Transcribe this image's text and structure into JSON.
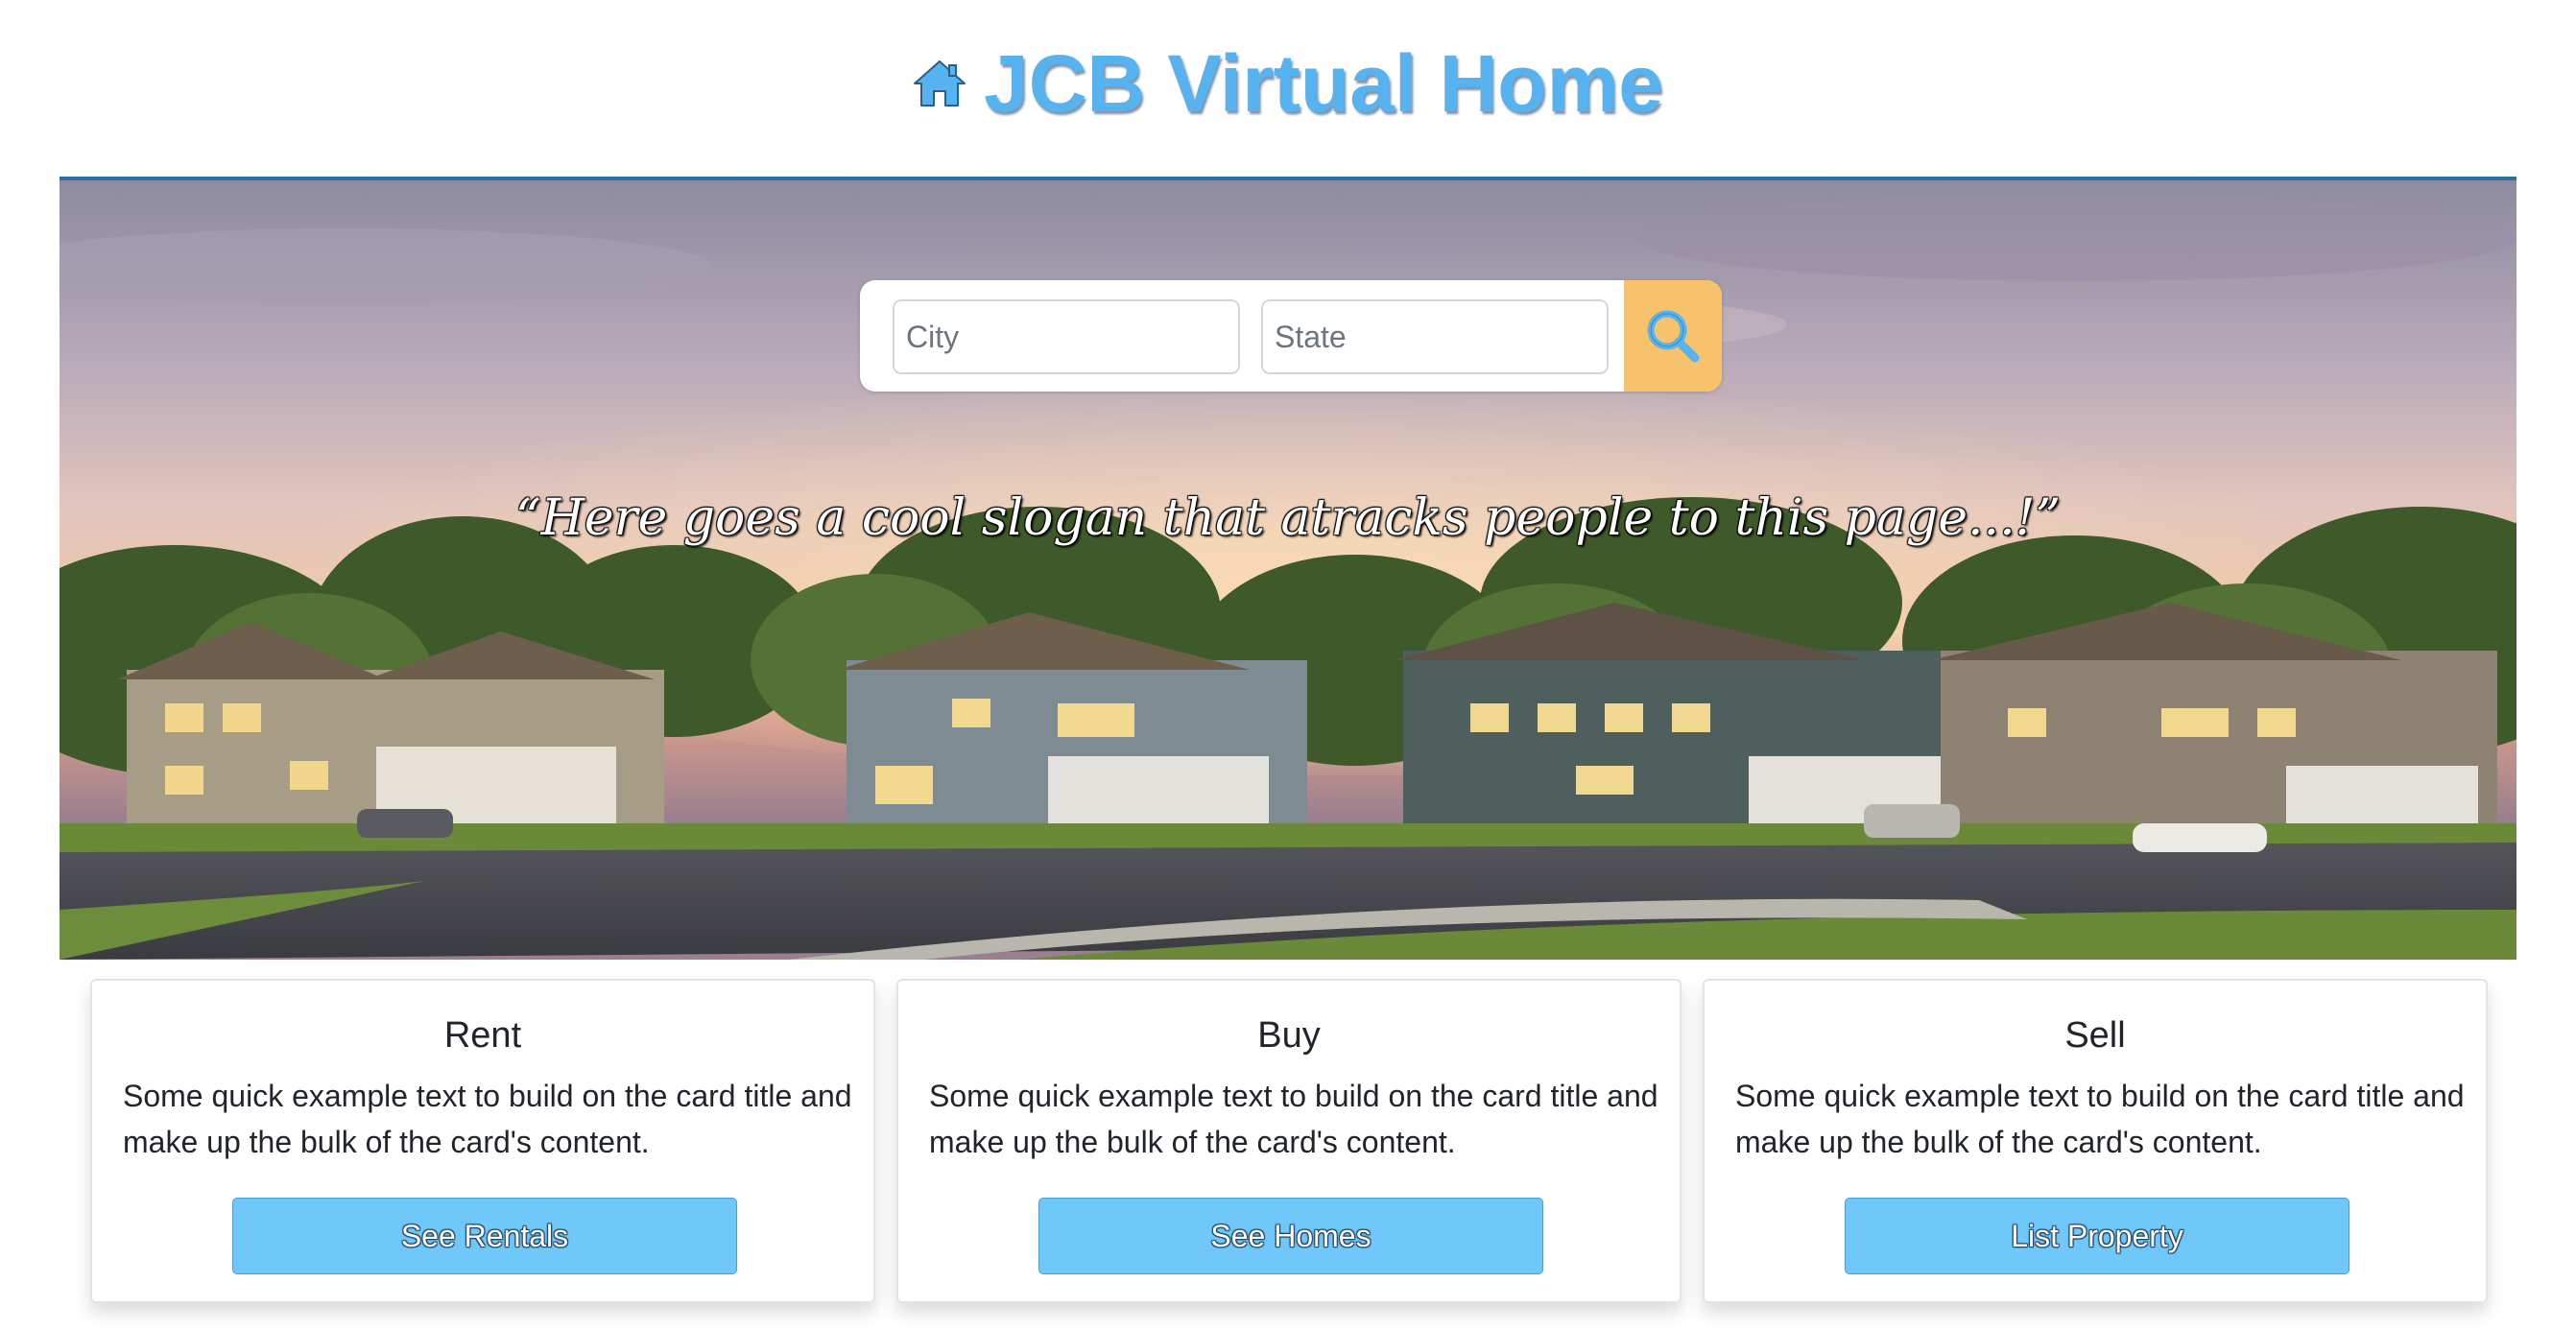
{
  "header": {
    "title": "JCB Virtual Home",
    "icon": "home-icon",
    "brand_color": "#57b3ef"
  },
  "hero": {
    "search": {
      "city_placeholder": "City",
      "state_placeholder": "State",
      "button_icon": "search-icon",
      "button_color": "#f6c26b"
    },
    "slogan": "“Here goes a cool slogan that atracks people to this page...!”"
  },
  "cards": [
    {
      "title": "Rent",
      "text": "Some quick example text to build on the card title and make up the bulk of the card's content.",
      "button_label": "See Rentals"
    },
    {
      "title": "Buy",
      "text": "Some quick example text to build on the card title and make up the bulk of the card's content.",
      "button_label": "See Homes"
    },
    {
      "title": "Sell",
      "text": "Some quick example text to build on the card title and make up the bulk of the card's content.",
      "button_label": "List Property"
    }
  ],
  "colors": {
    "accent": "#70c7fa",
    "header_rule": "#2b6f9e"
  }
}
